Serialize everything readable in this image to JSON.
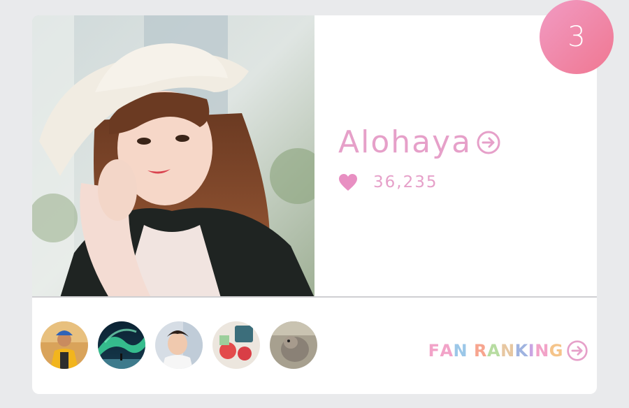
{
  "creator": {
    "name": "Alohaya",
    "likes": "36,235",
    "rank": "3"
  },
  "icons": {
    "name_link": "arrow-right-circle-icon",
    "likes": "heart-icon",
    "fan_link": "arrow-right-circle-icon"
  },
  "fan_ranking": {
    "label_letters": [
      "F",
      "A",
      "N",
      " ",
      "R",
      "A",
      "N",
      "K",
      "I",
      "N",
      "G"
    ],
    "label_colors": [
      "#f2a3c8",
      "#f2a3c8",
      "#9bc7e8",
      "#ffffff",
      "#f7a58f",
      "#b7dca1",
      "#e7c7a1",
      "#9fb3e0",
      "#c9a5e3",
      "#f2a3c8",
      "#f5c48a"
    ]
  },
  "colors": {
    "accent_pink": "#e6a0c9",
    "badge_start": "#f19bc3",
    "badge_end": "#f07791"
  }
}
